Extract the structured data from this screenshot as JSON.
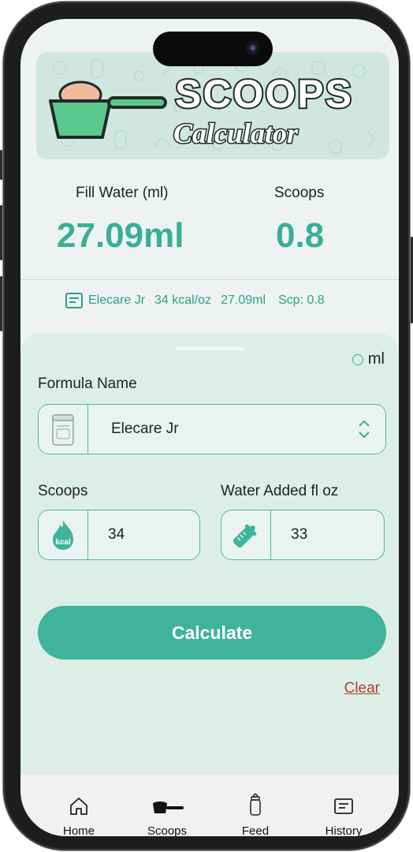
{
  "banner": {
    "title_line1": "SCOOPS",
    "title_line2": "Calculator"
  },
  "results": {
    "fill_water_label": "Fill Water (ml)",
    "fill_water_value": "27.09ml",
    "scoops_label": "Scoops",
    "scoops_value": "0.8"
  },
  "summary": {
    "icon": "receipt-icon",
    "formula": "Elecare Jr",
    "kcal": "34 kcal/oz",
    "water": "27.09ml",
    "scoops": "Scp: 0.8"
  },
  "form": {
    "unit_label": "ml",
    "formula_label": "Formula Name",
    "formula_value": "Elecare Jr",
    "scoops_label": "Scoops",
    "scoops_value": "34",
    "water_label": "Water Added fl oz",
    "water_value": "33",
    "kcal_badge": "kcal",
    "calculate_label": "Calculate",
    "clear_label": "Clear"
  },
  "tabs": [
    {
      "label": "Home",
      "icon": "home-icon"
    },
    {
      "label": "Scoops",
      "icon": "scoop-icon"
    },
    {
      "label": "Feed",
      "icon": "bottle-icon"
    },
    {
      "label": "History",
      "icon": "receipt-icon"
    }
  ],
  "colors": {
    "accent": "#3fb39b",
    "text_accent": "#3aae97",
    "clear": "#c0392b",
    "sheet": "#dcefe7"
  }
}
